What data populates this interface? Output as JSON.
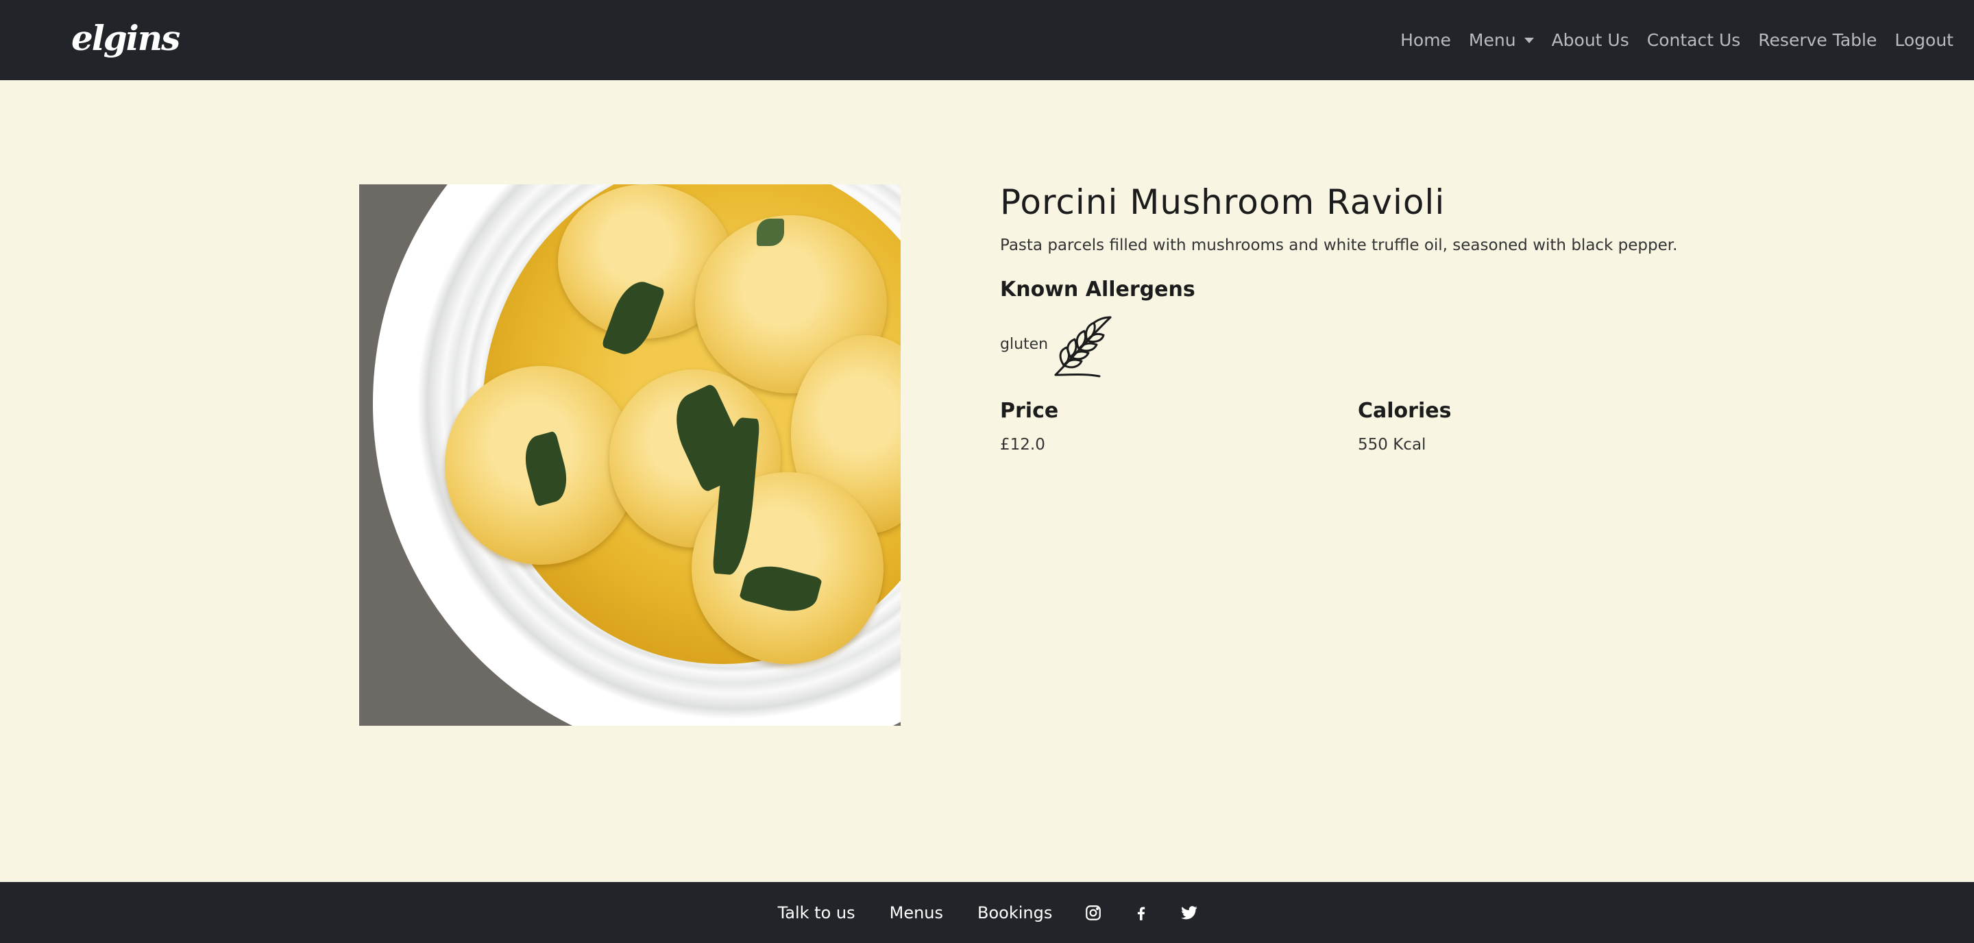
{
  "navbar": {
    "logo": "elgins",
    "links": {
      "home": "Home",
      "menu": "Menu",
      "about": "About Us",
      "contact": "Contact Us",
      "reserve": "Reserve Table",
      "logout": "Logout"
    }
  },
  "dish": {
    "title": "Porcini Mushroom Ravioli",
    "description": "Pasta parcels filled with mushrooms and white truffle oil, seasoned with black pepper.",
    "allergens_heading": "Known Allergens",
    "allergens": [
      {
        "name": "gluten",
        "icon": "wheat-icon"
      }
    ],
    "price_heading": "Price",
    "price": "£12.0",
    "calories_heading": "Calories",
    "calories": "550 Kcal"
  },
  "footer": {
    "links": {
      "talk": "Talk to us",
      "menus": "Menus",
      "bookings": "Bookings"
    },
    "social": [
      "instagram-icon",
      "facebook-icon",
      "twitter-icon"
    ]
  },
  "colors": {
    "background": "#f9f5e3",
    "navbar": "#212529",
    "nav_link": "#b9bcbf"
  }
}
